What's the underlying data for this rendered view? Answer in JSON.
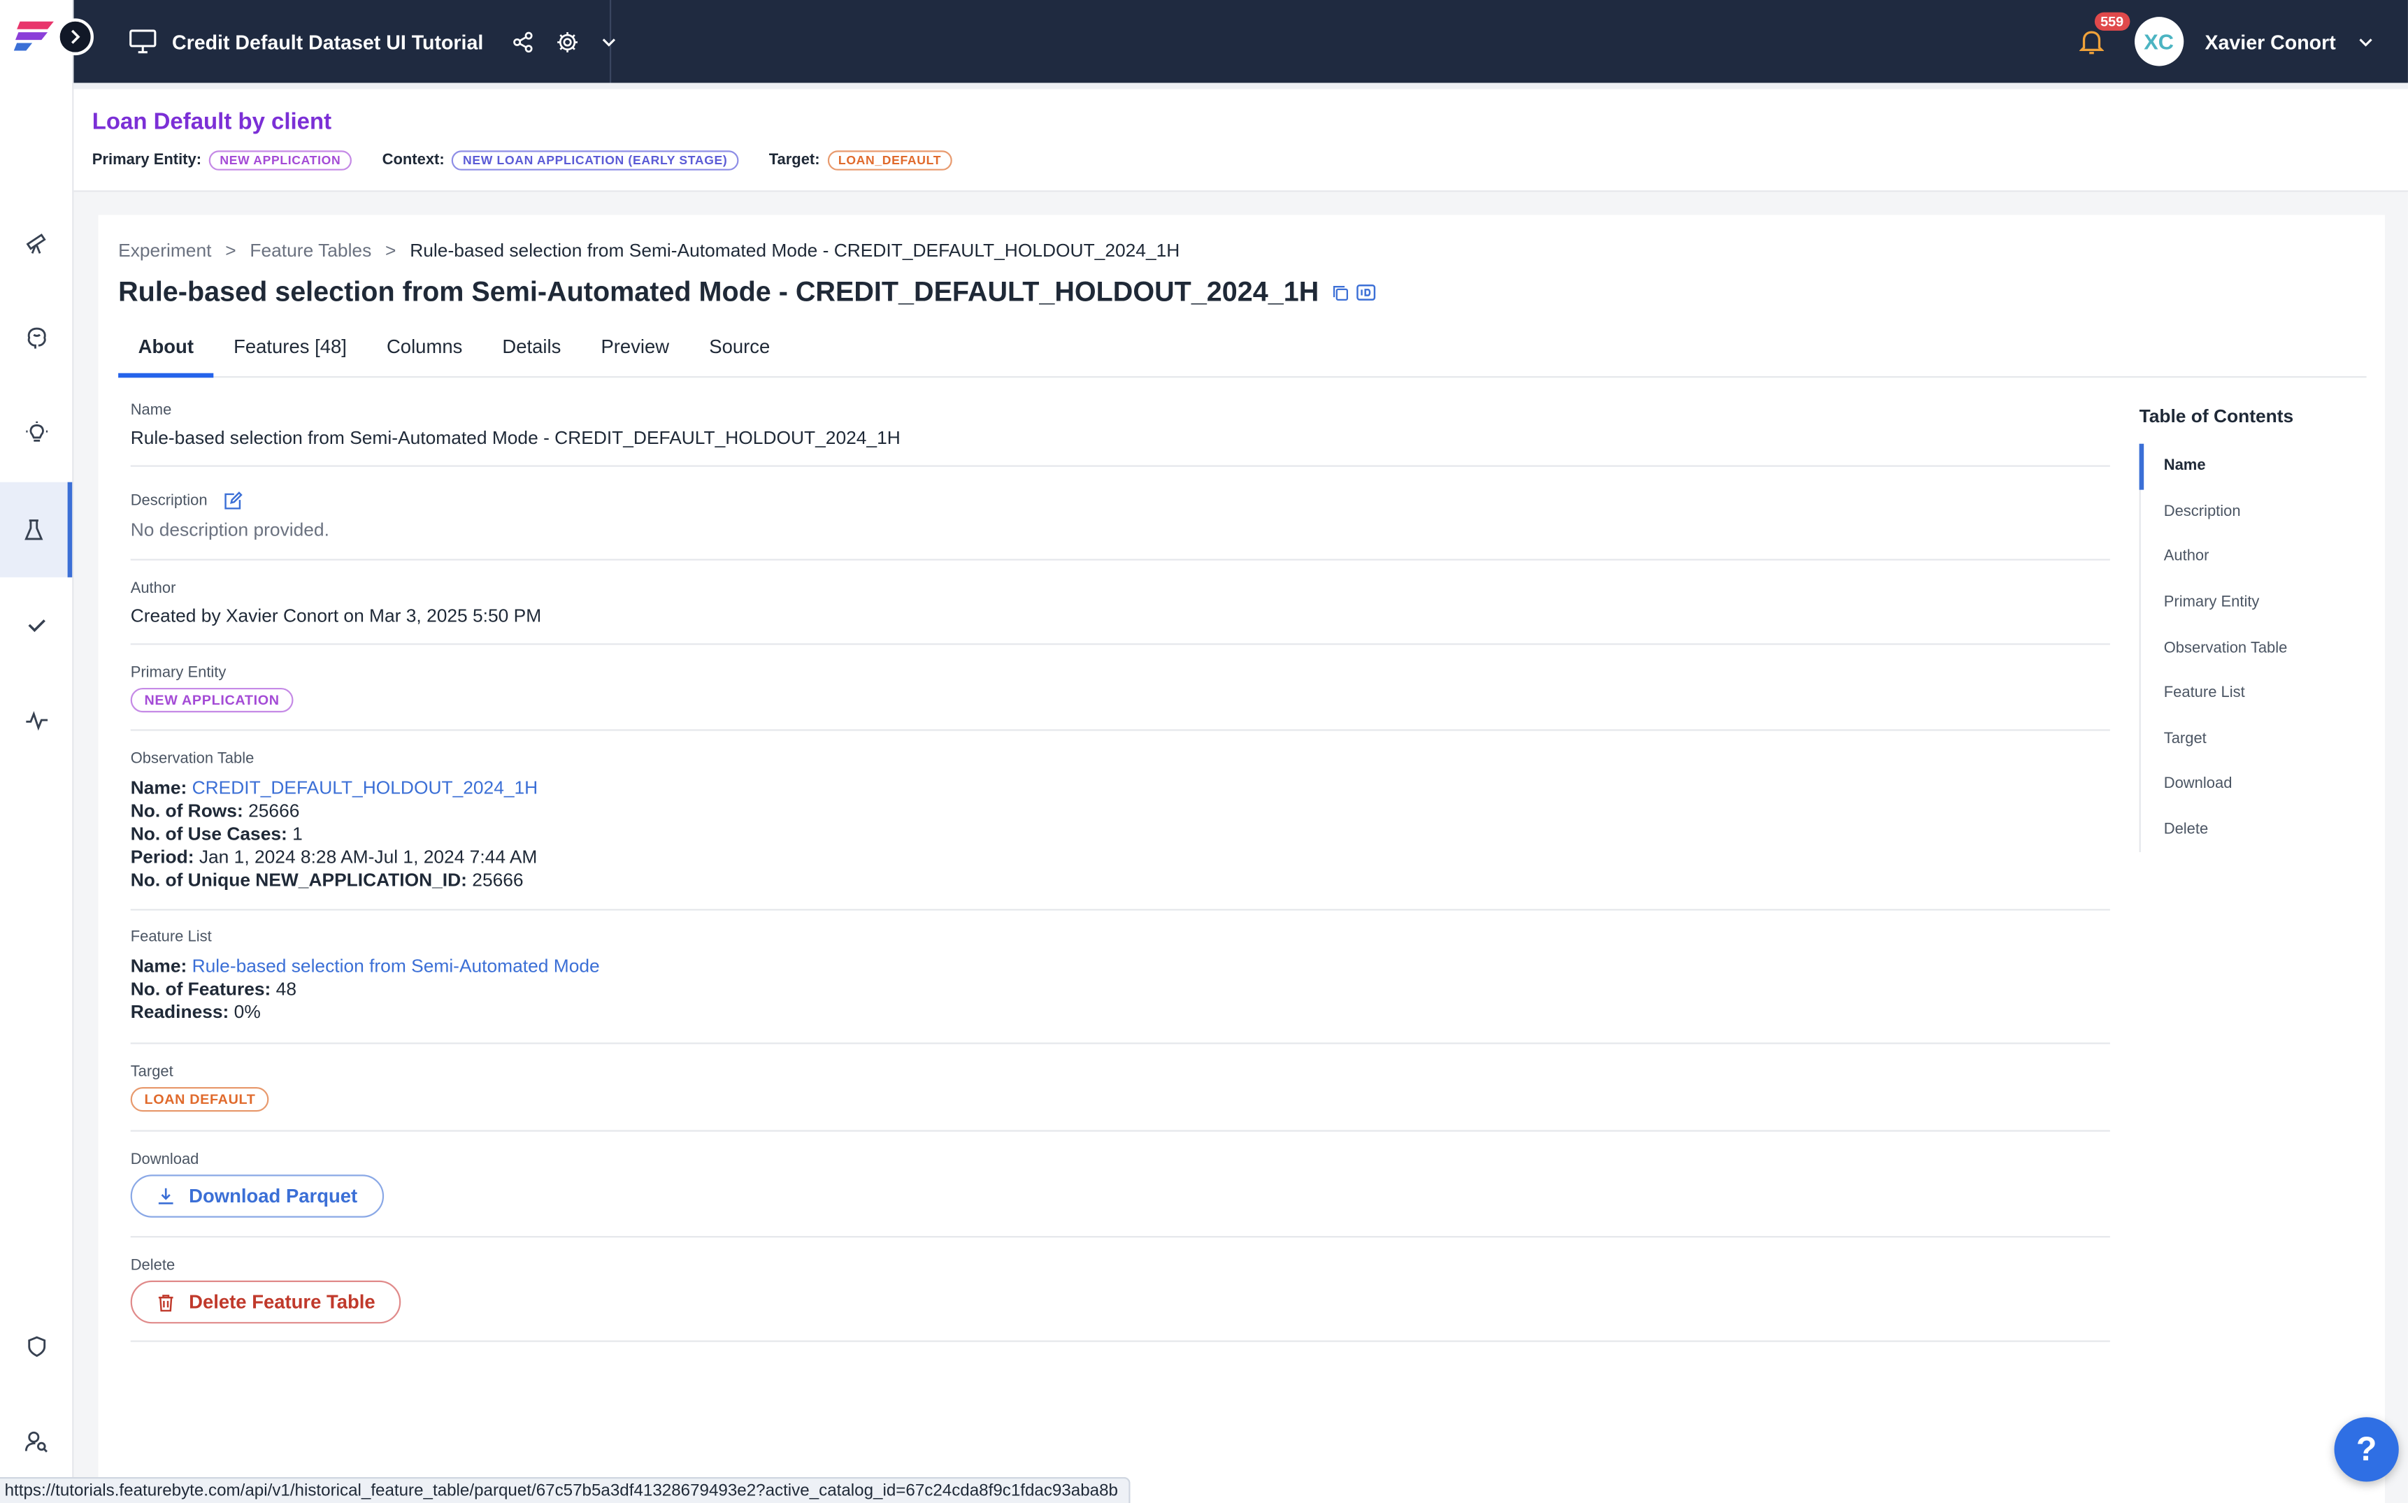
{
  "topbar": {
    "project_title": "Credit Default Dataset UI Tutorial",
    "notification_count": "559",
    "user_initials": "XC",
    "user_name": "Xavier Conort"
  },
  "context": {
    "title": "Loan Default by client",
    "primary_entity_label": "Primary Entity:",
    "primary_entity": "NEW APPLICATION",
    "context_label": "Context:",
    "context_value": "NEW LOAN APPLICATION (EARLY STAGE)",
    "target_label": "Target:",
    "target_value": "LOAN_DEFAULT"
  },
  "breadcrumb": {
    "items": [
      "Experiment",
      "Feature Tables",
      "Rule-based selection from Semi-Automated Mode - CREDIT_DEFAULT_HOLDOUT_2024_1H"
    ],
    "separator": ">"
  },
  "page_title": "Rule-based selection from Semi-Automated Mode - CREDIT_DEFAULT_HOLDOUT_2024_1H",
  "tabs": [
    {
      "label": "About"
    },
    {
      "label": "Features [48]"
    },
    {
      "label": "Columns"
    },
    {
      "label": "Details"
    },
    {
      "label": "Preview"
    },
    {
      "label": "Source"
    }
  ],
  "about": {
    "name_label": "Name",
    "name_value": "Rule-based selection from Semi-Automated Mode - CREDIT_DEFAULT_HOLDOUT_2024_1H",
    "description_label": "Description",
    "description_value": "No description provided.",
    "author_label": "Author",
    "author_value": "Created by Xavier Conort on Mar 3, 2025 5:50 PM",
    "primary_entity_label": "Primary Entity",
    "primary_entity_value": "NEW APPLICATION",
    "observation_label": "Observation Table",
    "obs_name_key": "Name:",
    "obs_name_value": "CREDIT_DEFAULT_HOLDOUT_2024_1H",
    "obs_rows_key": "No. of Rows:",
    "obs_rows_value": "25666",
    "obs_usecases_key": "No. of Use Cases:",
    "obs_usecases_value": "1",
    "obs_period_key": "Period:",
    "obs_period_value": "Jan 1, 2024 8:28 AM-Jul 1, 2024 7:44 AM",
    "obs_unique_key": "No. of Unique NEW_APPLICATION_ID:",
    "obs_unique_value": "25666",
    "feature_list_label": "Feature List",
    "fl_name_key": "Name:",
    "fl_name_value": "Rule-based selection from Semi-Automated Mode",
    "fl_features_key": "No. of Features:",
    "fl_features_value": "48",
    "fl_readiness_key": "Readiness:",
    "fl_readiness_value": "0%",
    "target_label": "Target",
    "target_value": "LOAN DEFAULT",
    "download_label": "Download",
    "download_button": "Download Parquet",
    "delete_label": "Delete",
    "delete_button": "Delete Feature Table"
  },
  "toc": {
    "title": "Table of Contents",
    "items": [
      "Name",
      "Description",
      "Author",
      "Primary Entity",
      "Observation Table",
      "Feature List",
      "Target",
      "Download",
      "Delete"
    ]
  },
  "status_url": "https://tutorials.featurebyte.com/api/v1/historical_feature_table/parquet/67c57b5a3df41328679493e2?active_catalog_id=67c24cda8f9c1fdac93aba8b",
  "help_label": "?",
  "colors": {
    "accent": "#2563eb",
    "topbar": "#1f2a40",
    "context_title": "#7b2fd6",
    "entity_pill": "#a44bd6",
    "target_pill": "#e06a2c",
    "delete": "#c0392b"
  }
}
